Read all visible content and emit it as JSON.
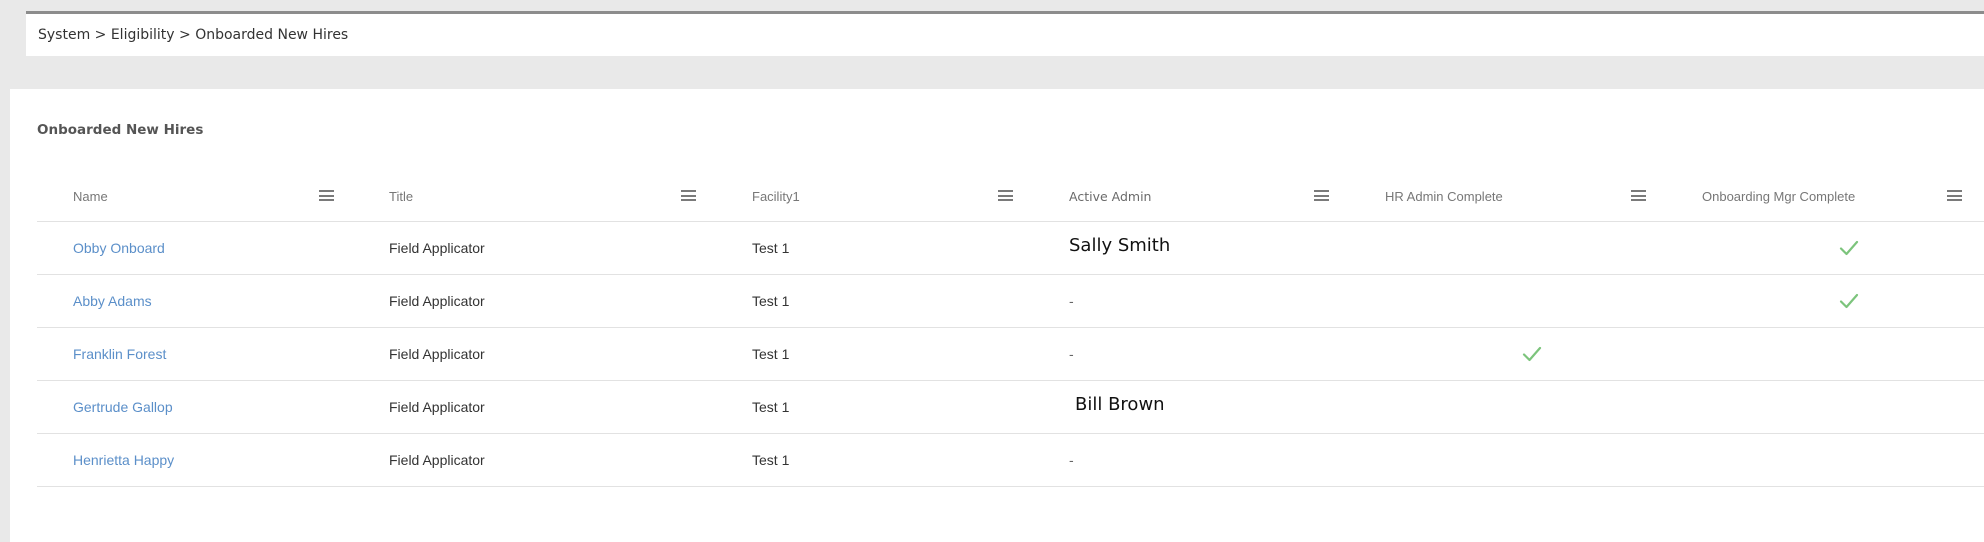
{
  "breadcrumb": {
    "text": "System > Eligibility > Onboarded New Hires"
  },
  "panel": {
    "title": "Onboarded New Hires"
  },
  "table": {
    "columns": [
      "Name",
      "Title",
      "Facility1",
      "Active Admin",
      "HR Admin Complete",
      "Onboarding Mgr Complete"
    ],
    "rows": [
      {
        "name": "Obby Onboard",
        "title": "Field Applicator",
        "facility": "Test 1",
        "admin": "Sally Smith",
        "hr_complete": false,
        "onboarding_complete": true
      },
      {
        "name": "Abby Adams",
        "title": "Field Applicator",
        "facility": "Test 1",
        "admin": "-",
        "hr_complete": false,
        "onboarding_complete": true
      },
      {
        "name": "Franklin Forest",
        "title": "Field Applicator",
        "facility": "Test 1",
        "admin": "-",
        "hr_complete": true,
        "onboarding_complete": false
      },
      {
        "name": "Gertrude Gallop",
        "title": "Field Applicator",
        "facility": "Test 1",
        "admin": "Bill Brown",
        "hr_complete": false,
        "onboarding_complete": false
      },
      {
        "name": "Henrietta Happy",
        "title": "Field Applicator",
        "facility": "Test 1",
        "admin": "-",
        "hr_complete": false,
        "onboarding_complete": false
      }
    ]
  },
  "colors": {
    "link": "#5b8fc9",
    "check": "#7cc47c",
    "page_bg": "#e9e9e9"
  },
  "icons": {
    "column_menu": "hamburger-icon",
    "complete": "checkmark-icon"
  }
}
